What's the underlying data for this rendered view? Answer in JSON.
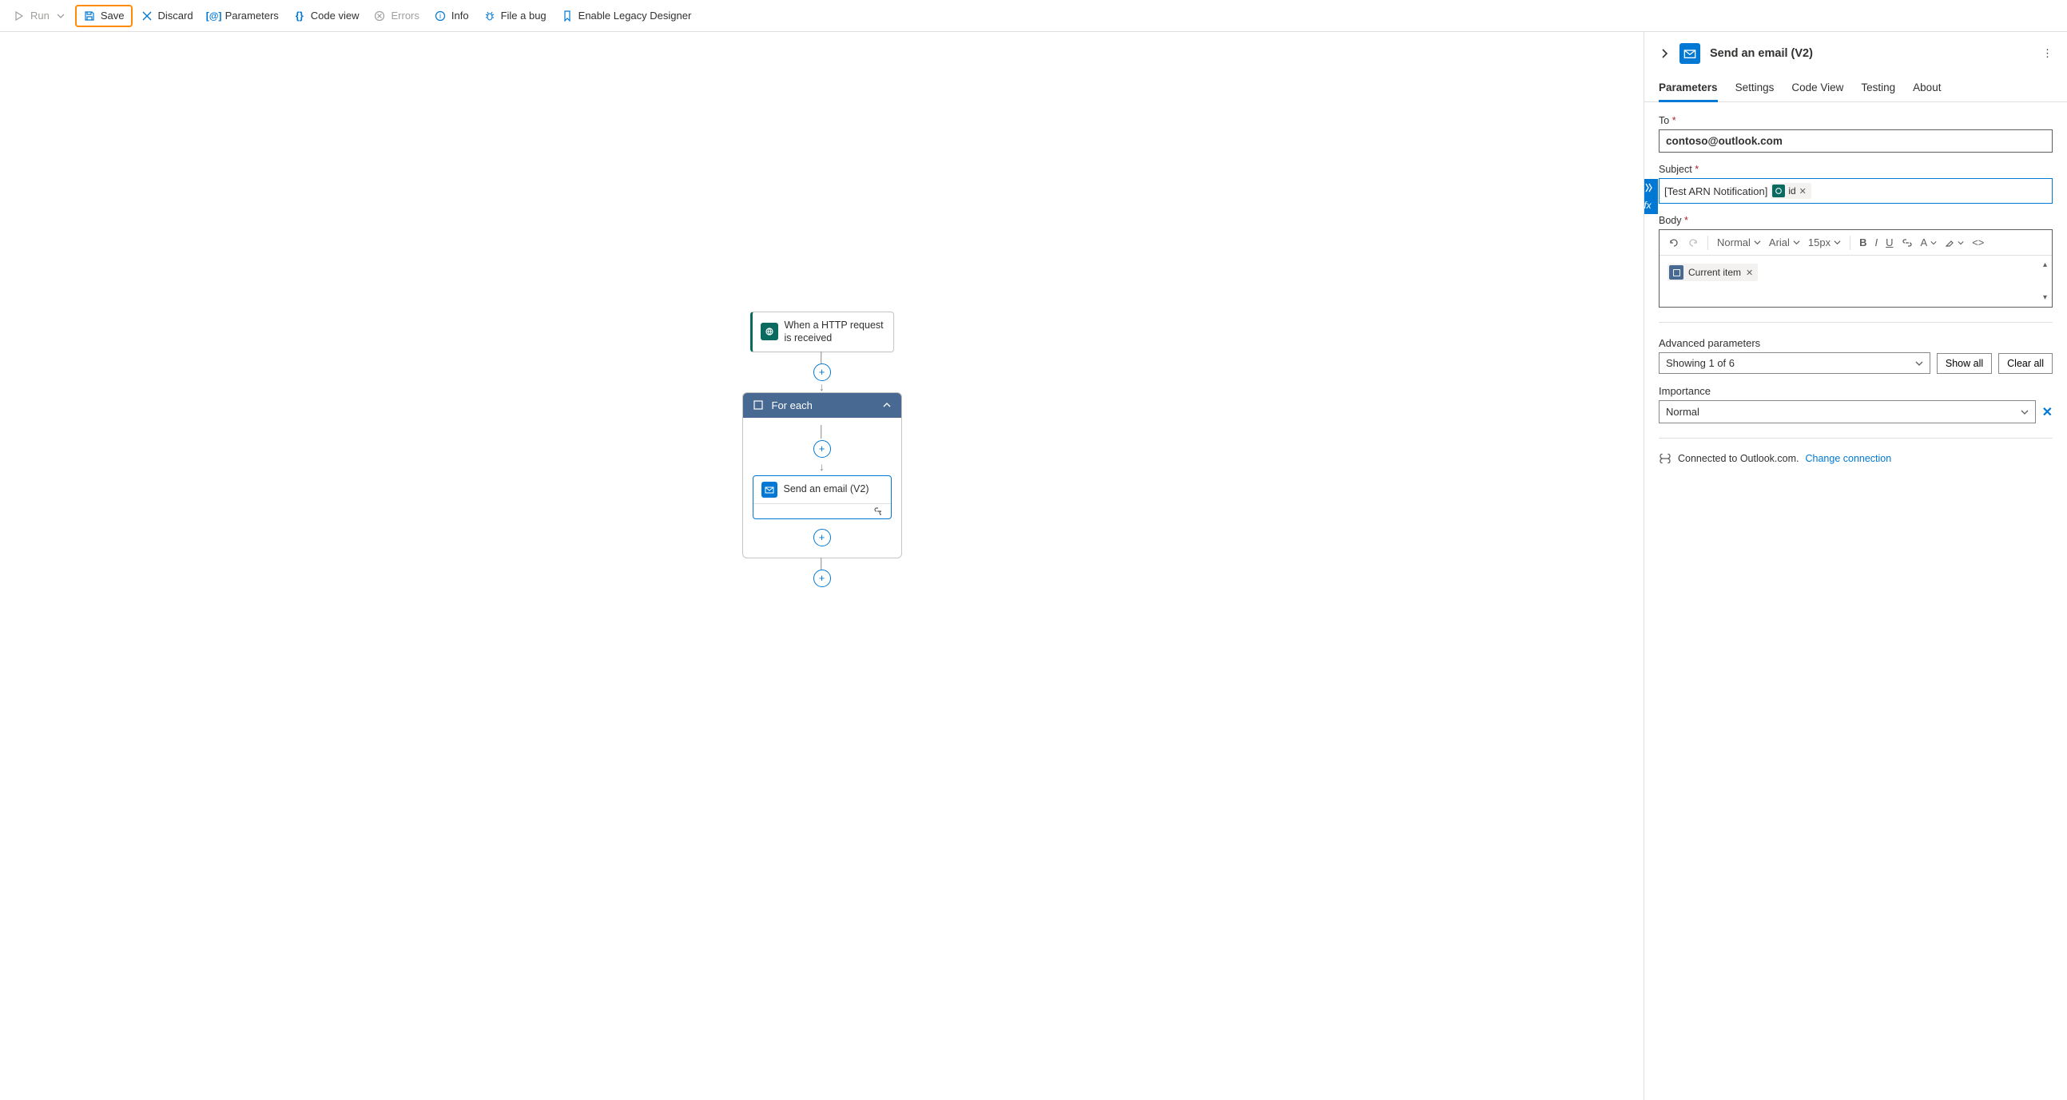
{
  "toolbar": {
    "run": "Run",
    "save": "Save",
    "discard": "Discard",
    "parameters": "Parameters",
    "code_view": "Code view",
    "errors": "Errors",
    "info": "Info",
    "file_bug": "File a bug",
    "legacy": "Enable Legacy Designer"
  },
  "workflow": {
    "trigger": "When a HTTP request is received",
    "foreach": "For each",
    "email_action": "Send an email (V2)"
  },
  "panel": {
    "title": "Send an email (V2)",
    "tabs": {
      "parameters": "Parameters",
      "settings": "Settings",
      "code_view": "Code View",
      "testing": "Testing",
      "about": "About"
    },
    "fields": {
      "to_label": "To",
      "to_value": "contoso@outlook.com",
      "subject_label": "Subject",
      "subject_text": "[Test ARN Notification]",
      "subject_token": "id",
      "body_label": "Body",
      "body_token": "Current item"
    },
    "rtf": {
      "style": "Normal",
      "font": "Arial",
      "size": "15px"
    },
    "advanced": {
      "label": "Advanced parameters",
      "showing": "Showing 1 of 6",
      "show_all": "Show all",
      "clear_all": "Clear all"
    },
    "importance": {
      "label": "Importance",
      "value": "Normal"
    },
    "connection": {
      "text": "Connected to Outlook.com.",
      "change": "Change connection"
    }
  }
}
